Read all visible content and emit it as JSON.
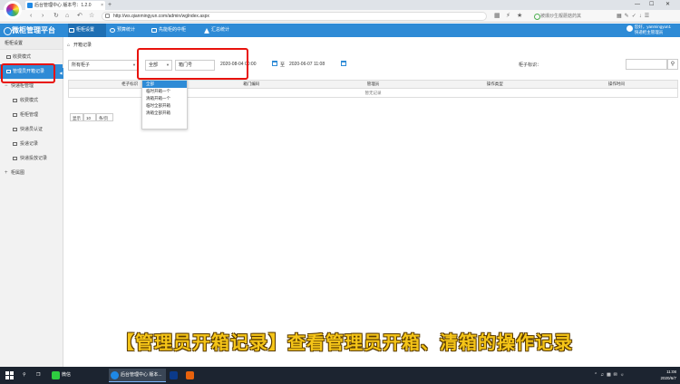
{
  "browser": {
    "tab_title": "后台管理中心 版本号：1.2.0",
    "tab_close": "×",
    "new_tab": "+",
    "url": "http://ws.qianmingyun.com/admin/wglndex.aspx",
    "search_hint": "被爆炒生靓蘑菇药其",
    "window_controls": [
      "—",
      "☐",
      "✕"
    ]
  },
  "app": {
    "brand": "微柜管理平台",
    "nav_tabs": [
      {
        "label": "柜柜设置",
        "active": true
      },
      {
        "label": "预算统计",
        "active": false
      },
      {
        "label": "先能柜的中柜",
        "active": false
      },
      {
        "label": "汇总统计",
        "active": false
      }
    ],
    "user": {
      "line1": "您好，yanmingyun1",
      "line2": "快递柜主管理员"
    }
  },
  "sidebar": {
    "top": "柜柜设置",
    "items": [
      {
        "label": "收费模式",
        "type": "item",
        "active": false
      },
      {
        "label": "管理员开箱记录",
        "type": "item",
        "active": true
      },
      {
        "label": "快递柜管理",
        "type": "group",
        "toggle": "−"
      },
      {
        "label": "收费模式",
        "type": "sub",
        "active": false
      },
      {
        "label": "柜柜管理",
        "type": "sub",
        "active": false
      },
      {
        "label": "快递员认证",
        "type": "sub",
        "active": false
      },
      {
        "label": "投递记录",
        "type": "sub",
        "active": false
      },
      {
        "label": "快递投放记录",
        "type": "sub",
        "active": false
      },
      {
        "label": "柜属图",
        "type": "group",
        "toggle": "+"
      }
    ],
    "collapse_toggle": "◀"
  },
  "main": {
    "breadcrumb": "开箱记录",
    "filters": {
      "cabinet_select": "所有柜子",
      "type_select": "全部",
      "box_no_placeholder": "箱门号",
      "date_from": "2020-08-04 00:00",
      "date_sep": "至",
      "date_to": "2020-06-07 11:08",
      "cabinet_id_label": "柜子标识：",
      "cabinet_id_value": "",
      "search_icon": "search-icon"
    },
    "dropdown_options": [
      "全部",
      "临时开箱一个",
      "清箱开箱一个",
      "临时全部开箱",
      "清箱全部开箱"
    ],
    "table": {
      "columns": [
        "柜子标识",
        "箱门编码",
        "管理员",
        "操作类型",
        "操作时间"
      ],
      "empty_text": "暂无记录"
    },
    "pager": {
      "show": "显示",
      "size": "10",
      "per_page": "条/页"
    }
  },
  "caption": "【管理员开箱记录】查看管理员开箱、清箱的操作记录",
  "taskbar": {
    "apps": [
      {
        "label": "微信",
        "color": "#2ecc40",
        "active": false
      },
      {
        "label": "后台管理中心 版本...",
        "color": "#1e88e5",
        "active": true
      },
      {
        "label": "",
        "color": "#0b3a8a",
        "active": false
      },
      {
        "label": "",
        "color": "#e8620c",
        "active": false
      }
    ],
    "time": "11:08",
    "date": "2020/6/7"
  },
  "colors": {
    "accent": "#2e8bd6",
    "highlight": "#e8120c",
    "caption": "#f5c518"
  }
}
